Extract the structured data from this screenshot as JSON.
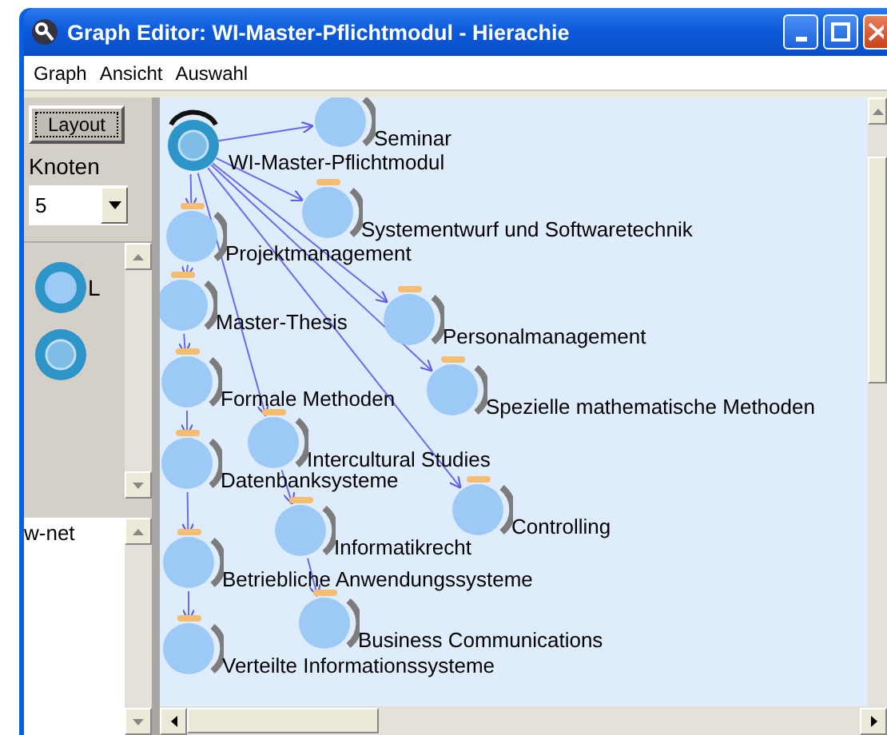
{
  "window": {
    "title": "Graph Editor: WI-Master-Pflichtmodul - Hierachie"
  },
  "menu": [
    "Graph",
    "Ansicht",
    "Auswahl"
  ],
  "sidebar": {
    "layout_button": "Layout",
    "nodes_label": "Knoten",
    "nodes_value": "5",
    "list_items": [
      {
        "kind": "module",
        "label": "L"
      },
      {
        "kind": "root"
      }
    ],
    "text_area": "w-net"
  },
  "graph": {
    "nodes": [
      {
        "kind": "module",
        "label": "Seminar"
      },
      {
        "kind": "root",
        "label": "WI-Master-Pflichtmodul"
      },
      {
        "kind": "module",
        "label": "Systementwurf und Softwaretechnik",
        "marked": true
      },
      {
        "kind": "module",
        "label": "Projektmanagement",
        "marked": true
      },
      {
        "kind": "module",
        "label": "Master-Thesis",
        "marked": true
      },
      {
        "kind": "module",
        "label": "Personalmanagement",
        "marked": true
      },
      {
        "kind": "module",
        "label": "Formale Methoden",
        "marked": true
      },
      {
        "kind": "module",
        "label": "Spezielle mathematische Methoden",
        "marked": true
      },
      {
        "kind": "module",
        "label": "Intercultural Studies",
        "marked": true
      },
      {
        "kind": "module",
        "label": "Datenbanksysteme",
        "marked": true
      },
      {
        "kind": "module",
        "label": "Controlling",
        "marked": true
      },
      {
        "kind": "module",
        "label": "Informatikrecht",
        "marked": true
      },
      {
        "kind": "module",
        "label": "Betriebliche Anwendungssysteme",
        "marked": true
      },
      {
        "kind": "module",
        "label": "Business Communications",
        "marked": true
      },
      {
        "kind": "module",
        "label": "Verteilte Informationssysteme",
        "marked": true
      }
    ]
  }
}
